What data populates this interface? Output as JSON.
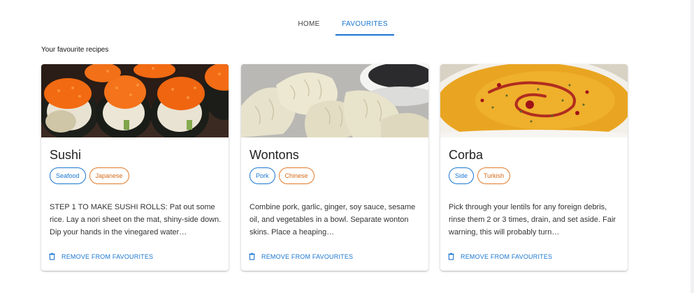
{
  "tabs": [
    {
      "label": "HOME"
    },
    {
      "label": "FAVOURITES"
    }
  ],
  "section_heading": "Your favourite recipes",
  "colors": {
    "accent": "#1976d2",
    "area_chip": "#d46a1a"
  },
  "cards": [
    {
      "title": "Sushi",
      "category": "Seafood",
      "area": "Japanese",
      "description": "STEP 1 TO MAKE SUSHI ROLLS: Pat out some rice. Lay a nori sheet on the mat, shiny-side down. Dip your hands in the vinegared water…",
      "remove_label": "REMOVE FROM FAVOURITES",
      "image": "sushi-rolls-image"
    },
    {
      "title": "Wontons",
      "category": "Pork",
      "area": "Chinese",
      "description": "Combine pork, garlic, ginger, soy sauce, sesame oil, and vegetables in a bowl. Separate wonton skins. Place a heaping…",
      "remove_label": "REMOVE FROM FAVOURITES",
      "image": "wontons-image"
    },
    {
      "title": "Corba",
      "category": "Side",
      "area": "Turkish",
      "description": "Pick through your lentils for any foreign debris, rinse them 2 or 3 times, drain, and set aside. Fair warning, this will probably turn…",
      "remove_label": "REMOVE FROM FAVOURITES",
      "image": "corba-soup-image"
    }
  ]
}
